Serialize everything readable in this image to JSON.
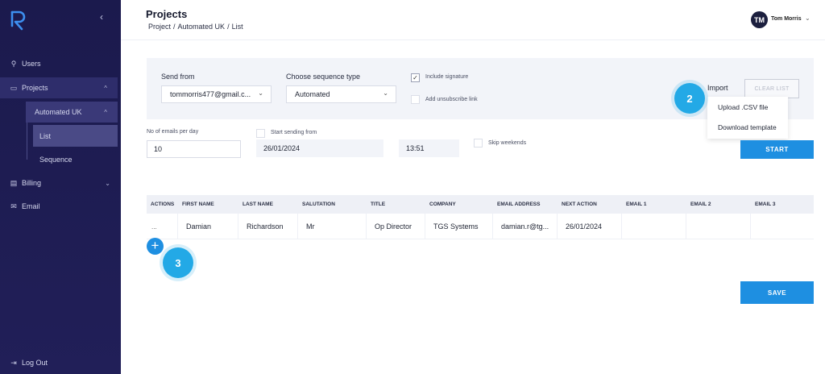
{
  "app": {
    "page_title": "Projects",
    "breadcrumb": [
      "Project",
      "Automated UK",
      "List"
    ],
    "user": {
      "initials": "TM",
      "name": "Tom Morris"
    }
  },
  "sidebar": {
    "items": [
      {
        "label": "Users",
        "icon": "user-icon"
      },
      {
        "label": "Projects",
        "icon": "folder-icon"
      },
      {
        "label": "Automated UK"
      },
      {
        "label": "List"
      },
      {
        "label": "Sequence"
      },
      {
        "label": "Billing",
        "icon": "card-icon"
      },
      {
        "label": "Email",
        "icon": "mail-icon"
      },
      {
        "label": "Log Out",
        "icon": "logout-icon"
      }
    ]
  },
  "settings": {
    "send_from_label": "Send from",
    "send_from_value": "tommorris477@gmail.c...",
    "sequence_type_label": "Choose sequence type",
    "sequence_type_value": "Automated",
    "include_signature": "Include signature",
    "add_unsubscribe": "Add unsubscribe link",
    "import_label": "Import",
    "clear_list": "CLEAR LIST",
    "import_menu": [
      "Upload .CSV file",
      "Download template"
    ],
    "emails_per_day_label": "No of emails per day",
    "emails_per_day_value": "10",
    "start_sending_label": "Start sending from",
    "start_date": "26/01/2024",
    "start_time": "13:51",
    "skip_weekends": "Skip weekends",
    "start_button": "START"
  },
  "step_badges": [
    "2",
    "3"
  ],
  "table": {
    "columns": [
      "ACTIONS",
      "FIRST NAME",
      "LAST NAME",
      "SALUTATION",
      "TITLE",
      "COMPANY",
      "EMAIL ADDRESS",
      "NEXT ACTION",
      "EMAIL 1",
      "EMAIL 2",
      "EMAIL 3"
    ],
    "rows": [
      {
        "actions": "...",
        "first_name": "Damian",
        "last_name": "Richardson",
        "salutation": "Mr",
        "title": "Op Director",
        "company": "TGS Systems",
        "email": "damian.r@tg...",
        "next_action": "26/01/2024",
        "email1": "",
        "email2": "",
        "email3": ""
      }
    ]
  },
  "save_button": "SAVE",
  "colors": {
    "sidebar": "#1b1a4d",
    "accent": "#1e8fe1",
    "badge": "#23a9e6"
  }
}
